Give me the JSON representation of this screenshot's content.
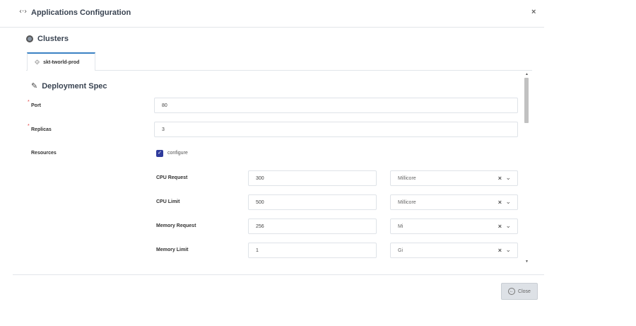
{
  "header": {
    "icon": "code-icon",
    "title": "Applications Configuration",
    "close_label": "×"
  },
  "clusters": {
    "icon": "cluster-icon",
    "label": "Clusters",
    "tabs": [
      {
        "label": "skt-tworld-prod",
        "icon": "settings-cluster-icon"
      }
    ]
  },
  "section": {
    "icon": "pencil-icon",
    "title": "Deployment Spec"
  },
  "fields": {
    "port": {
      "label": "Port",
      "required": true,
      "value": "80"
    },
    "replicas": {
      "label": "Replicas",
      "required": true,
      "value": "3"
    },
    "resources": {
      "label": "Resources",
      "checkbox_label": "configure",
      "checked": true
    }
  },
  "resources": [
    {
      "label": "CPU Request",
      "value": "300",
      "unit": "Millicore"
    },
    {
      "label": "CPU Limit",
      "value": "500",
      "unit": "Millicore"
    },
    {
      "label": "Memory Request",
      "value": "256",
      "unit": "Mi"
    },
    {
      "label": "Memory Limit",
      "value": "1",
      "unit": "Gi"
    }
  ],
  "select_clear": "×",
  "select_chevron": "❯",
  "required_mark": "*",
  "footer": {
    "close_label": "Close",
    "close_icon": "back-circle-icon"
  }
}
